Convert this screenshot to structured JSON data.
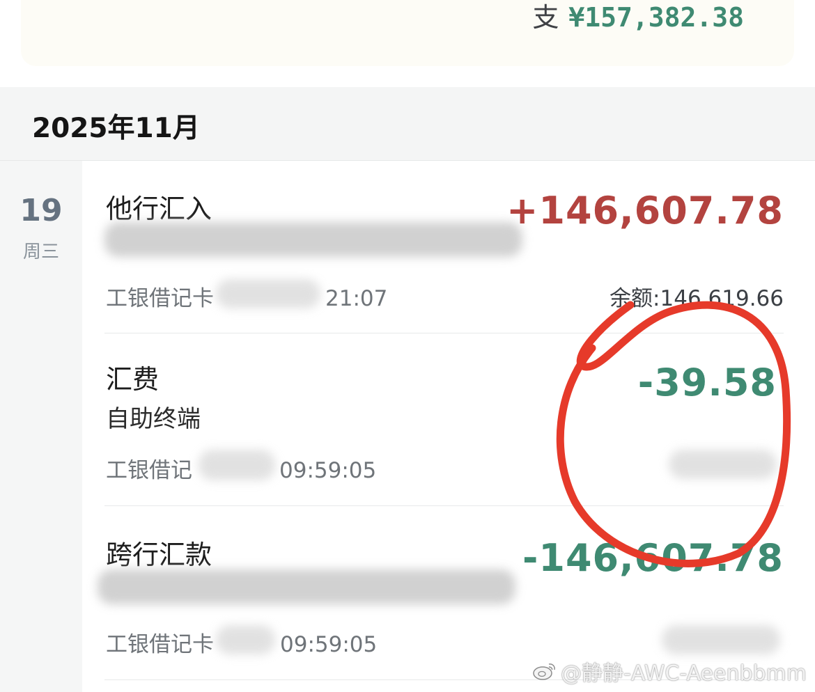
{
  "summary": {
    "expense_label": "支",
    "expense_amount": "¥157,382.38"
  },
  "month": {
    "title": "2025年11月"
  },
  "date_group": {
    "day": "19",
    "weekday": "周三"
  },
  "transactions": [
    {
      "title": "他行汇入",
      "subtitle": "",
      "meta_visible_start": "工银借记卡",
      "meta_visible_end": "21:07",
      "amount": "+146,607.78",
      "balance": "余额:146,619.66",
      "direction": "in"
    },
    {
      "title": "汇费",
      "subtitle": "自助终端",
      "meta_visible_start": "工银借记",
      "meta_visible_end": "09:59:05",
      "amount": "-39.58",
      "balance": "",
      "direction": "out"
    },
    {
      "title": "跨行汇款",
      "subtitle": "",
      "meta_visible_start": "工银借记卡",
      "meta_visible_end": "09:59:05",
      "amount": "-146,607.78",
      "balance": "",
      "direction": "out"
    }
  ],
  "watermark": {
    "text": "@静静-AWC-Aeenbbmm",
    "icon": "weibo-logo-icon"
  },
  "colors": {
    "income": "#b3433f",
    "expense": "#3f8a72",
    "annotation": "#e63a2a"
  }
}
